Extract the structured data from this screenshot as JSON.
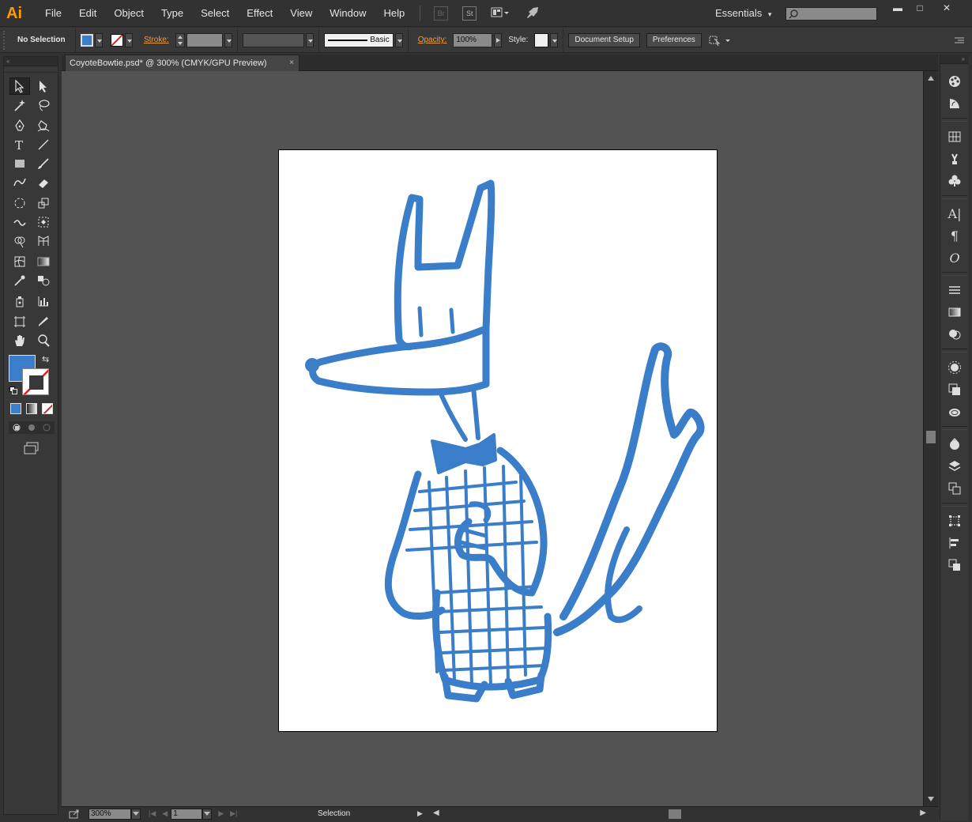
{
  "app": {
    "logo_text": "Ai",
    "menus": [
      "File",
      "Edit",
      "Object",
      "Type",
      "Select",
      "Effect",
      "View",
      "Window",
      "Help"
    ],
    "bridge_label": "Br",
    "stock_label": "St",
    "workspace": "Essentials",
    "search_placeholder": "",
    "window_controls": {
      "minimize": "▬",
      "restore": "□",
      "close": "✕"
    }
  },
  "control_bar": {
    "selection_status": "No Selection",
    "stroke_label": "Stroke:",
    "stroke_profile_label": "Basic",
    "opacity_label": "Opacity:",
    "opacity_value": "100%",
    "style_label": "Style:",
    "document_setup": "Document Setup",
    "preferences": "Preferences",
    "fill_color": "#3a7dc9"
  },
  "document": {
    "tab_title": "CoyoteBowtie.psd* @ 300% (CMYK/GPU Preview)",
    "tab_close": "×",
    "artwork_color": "#3a7dc9"
  },
  "status_bar": {
    "zoom": "300%",
    "artboard_number": "1",
    "current_tool": "Selection"
  },
  "toolbar": {
    "fill_color": "#3a7dc9",
    "stroke_color": "none",
    "tools": [
      "selection-tool",
      "direct-selection-tool",
      "magic-wand-tool",
      "lasso-tool",
      "pen-tool",
      "curvature-tool",
      "type-tool",
      "line-segment-tool",
      "rectangle-tool",
      "paintbrush-tool",
      "shaper-tool",
      "eraser-tool",
      "rotate-tool",
      "scale-tool",
      "width-tool",
      "free-transform-tool",
      "shape-builder-tool",
      "perspective-grid-tool",
      "mesh-tool",
      "gradient-tool",
      "eyedropper-tool",
      "blend-tool",
      "symbol-sprayer-tool",
      "column-graph-tool",
      "artboard-tool",
      "slice-tool",
      "hand-tool",
      "zoom-tool"
    ]
  },
  "right_panels": [
    "color-panel",
    "color-guide-panel",
    "swatches-panel",
    "brushes-panel",
    "symbols-panel",
    "character-panel",
    "paragraph-panel",
    "opentype-panel",
    "stroke-panel",
    "gradient-panel",
    "transparency-panel",
    "appearance-panel",
    "graphic-styles-panel",
    "cc-libraries-panel",
    "asset-export-panel",
    "layers-panel",
    "artboards-panel",
    "transform-panel",
    "align-panel",
    "pathfinder-panel"
  ]
}
